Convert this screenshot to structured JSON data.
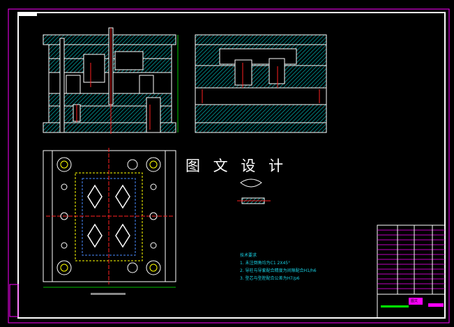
{
  "watermark": "图 文 设 计",
  "notes": {
    "title": "技术要求",
    "items": [
      "1. 未注倒角均为C1 2X45°",
      "2. 导柱与导套配合精度为间隙配合H1/h6",
      "3. 型芯与型腔配合公差为H7/p6"
    ]
  },
  "title_block": {
    "logo_text": "图文"
  },
  "colors": {
    "frame": "#ff00ff",
    "border": "#ffffff",
    "hatch": "#00c8c8",
    "centerline": "#ff2020",
    "notes": "#19d3e6",
    "dim": "#ffff00"
  }
}
